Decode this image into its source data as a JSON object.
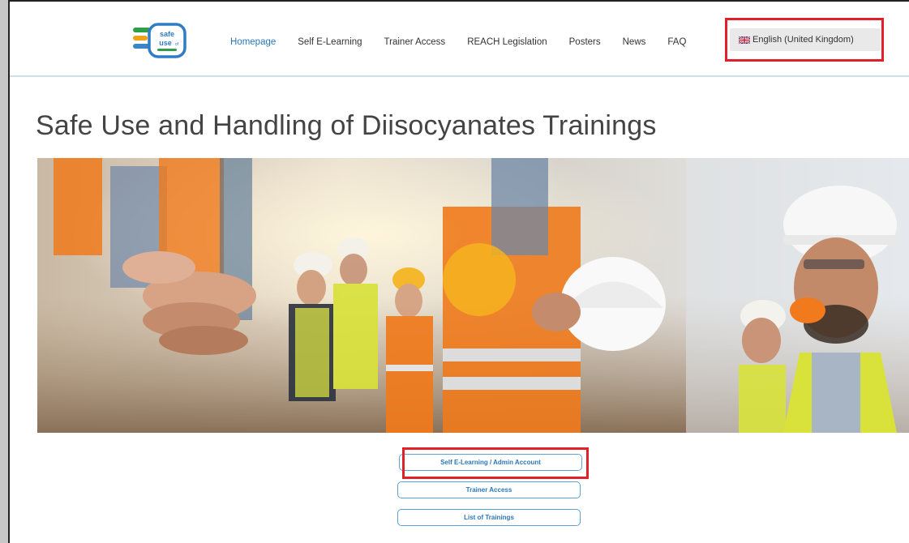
{
  "logo": {
    "line1": "safe",
    "line2": "use",
    "line3": "of"
  },
  "nav": {
    "items": [
      {
        "label": "Homepage"
      },
      {
        "label": "Self E-Learning"
      },
      {
        "label": "Trainer Access"
      },
      {
        "label": "REACH Legislation"
      },
      {
        "label": "Posters"
      },
      {
        "label": "News"
      },
      {
        "label": "FAQ"
      }
    ],
    "language_label": "English (United Kingdom)"
  },
  "page": {
    "title": "Safe Use and Handling of Diisocyanates Trainings"
  },
  "buttons": {
    "self_elearning": "Self E-Learning / Admin Account",
    "trainer_access": "Trainer Access",
    "list_of_trainings": "List of Trainings"
  },
  "colors": {
    "accent": "#2a77b9",
    "button_border": "#5aa3d8",
    "highlight": "#e0212a",
    "vest_orange": "#f07a1c",
    "vest_yellow": "#d8e23a"
  }
}
